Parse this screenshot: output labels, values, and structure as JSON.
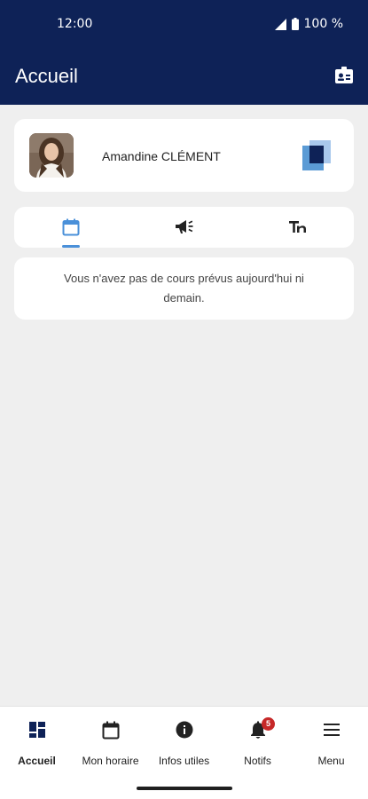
{
  "status_bar": {
    "time": "12:00",
    "battery": "100 %"
  },
  "app_bar": {
    "title": "Accueil",
    "action_icon": "id-card-icon"
  },
  "profile": {
    "name": "Amandine CLÉMENT",
    "avatar_icon": "avatar-photo",
    "switch_icon": "account-switch-icon"
  },
  "tabs": [
    {
      "icon": "calendar-icon",
      "active": true
    },
    {
      "icon": "megaphone-icon",
      "active": false
    },
    {
      "icon": "text-icon",
      "active": false
    }
  ],
  "message": {
    "text": "Vous n'avez pas de cours prévus aujourd'hui ni demain."
  },
  "bottom_nav": {
    "items": [
      {
        "label": "Accueil",
        "icon": "dashboard-icon",
        "active": true
      },
      {
        "label": "Mon horaire",
        "icon": "calendar-icon",
        "active": false
      },
      {
        "label": "Infos utiles",
        "icon": "info-icon",
        "active": false
      },
      {
        "label": "Notifs",
        "icon": "bell-icon",
        "active": false,
        "badge": "5"
      },
      {
        "label": "Menu",
        "icon": "menu-icon",
        "active": false
      }
    ]
  },
  "colors": {
    "primary": "#0e2257",
    "accent": "#4a90d9",
    "badge": "#c62828",
    "background": "#efefef"
  }
}
